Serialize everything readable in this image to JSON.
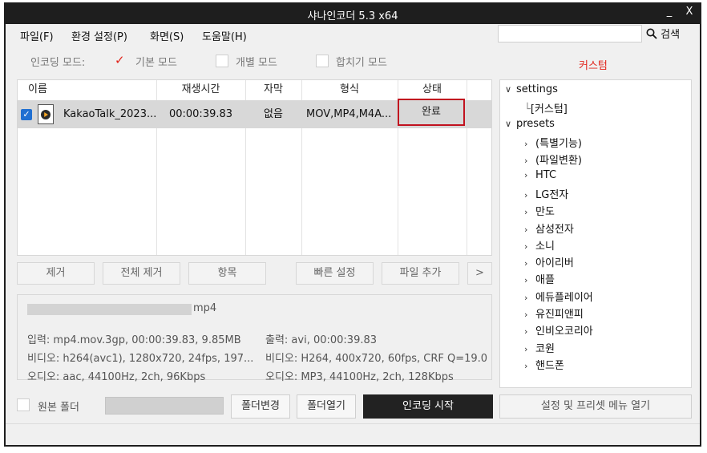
{
  "window": {
    "title": "샤나인코더  5.3  x64",
    "minimize_label": "_",
    "close_label": "X"
  },
  "menu": [
    {
      "label": "파일(F)"
    },
    {
      "label": "환경 설정(P)"
    },
    {
      "label": "화면(S)"
    },
    {
      "label": "도움말(H)"
    }
  ],
  "search": {
    "value": "",
    "button_label": "검색"
  },
  "mode": {
    "label": "인코딩 모드:",
    "options": [
      {
        "label": "기본 모드",
        "checked": true
      },
      {
        "label": "개별 모드",
        "checked": false
      },
      {
        "label": "합치기 모드",
        "checked": false
      }
    ],
    "custom_label": "커스텀"
  },
  "filelist": {
    "columns": [
      "이름",
      "재생시간",
      "자막",
      "형식",
      "상태"
    ],
    "rows": [
      {
        "name": "KakaoTalk_2023...",
        "duration": "00:00:39.83",
        "subtitle": "없음",
        "format": "MOV,MP4,M4A...",
        "status": "완료",
        "checked": true
      }
    ]
  },
  "actions": {
    "remove": "제거",
    "remove_all": "전체 제거",
    "item": "항목",
    "quick_settings": "빠른 설정",
    "add_file": "파일 추가",
    "more": ">"
  },
  "info": {
    "filename_suffix": "mp4",
    "input_label": "입력: mp4.mov.3gp, 00:00:39.83, 9.85MB",
    "input_video": "비디오: h264(avc1), 1280x720, 24fps, 197...",
    "input_audio": "오디오: aac, 44100Hz, 2ch, 96Kbps",
    "output_label": "출력: avi, 00:00:39.83",
    "output_video": "비디오: H264, 400x720, 60fps, CRF Q=19.0",
    "output_audio": "오디오: MP3, 44100Hz, 2ch, 128Kbps"
  },
  "tree": {
    "settings": "settings",
    "custom": "[커스텀]",
    "presets": "presets",
    "items": [
      "(특별기능)",
      "(파일변환)",
      "HTC",
      "LG전자",
      "만도",
      "삼성전자",
      "소니",
      "아이리버",
      "애플",
      "에듀플레이어",
      "유진피앤피",
      "인비오코리아",
      "코원",
      "핸드폰"
    ]
  },
  "bottom": {
    "original_folder": "원본 폴더",
    "folder_path": "",
    "change_folder": "폴더변경",
    "open_folder": "폴더열기",
    "start_encoding": "인코딩 시작",
    "open_settings_menu": "설정 및 프리셋 메뉴 열기"
  }
}
